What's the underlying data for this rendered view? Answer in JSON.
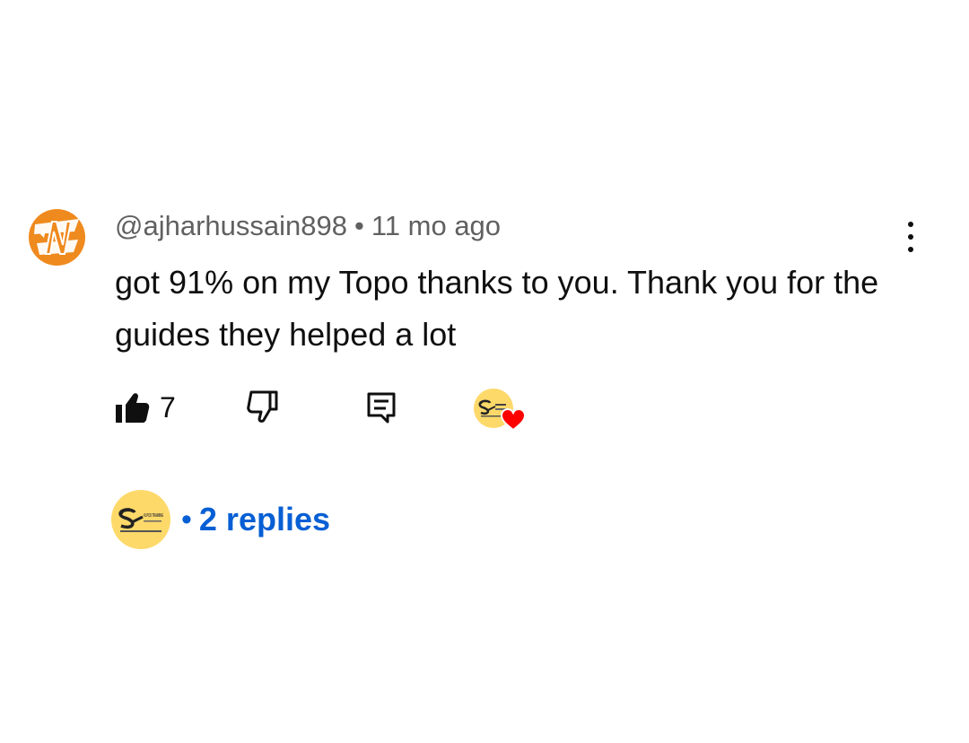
{
  "comment": {
    "author": "@ajharhussain898",
    "separator": "•",
    "age": "11 mo ago",
    "text": "got 91% on my Topo thanks to you. Thank you for the guides they helped a lot",
    "author_avatar_icon": "orange-n-logo-avatar"
  },
  "actions": {
    "like_count": "7",
    "like_icon": "thumbs-up-filled-icon",
    "dislike_icon": "thumbs-down-outline-icon",
    "reply_icon": "comment-reply-icon",
    "creator_heart_icon": "creator-heart-badge",
    "menu_icon": "more-vertical-icon"
  },
  "replies": {
    "separator": "•",
    "label": "2 replies",
    "avatar_text": "#1 PCO TRAINING"
  },
  "colors": {
    "author_avatar": "#ef8a1e",
    "channel_avatar": "#fdd96a",
    "link_blue": "#065fd4",
    "heart_red": "#ff0000",
    "meta_gray": "#606060",
    "text": "#0f0f0f"
  }
}
